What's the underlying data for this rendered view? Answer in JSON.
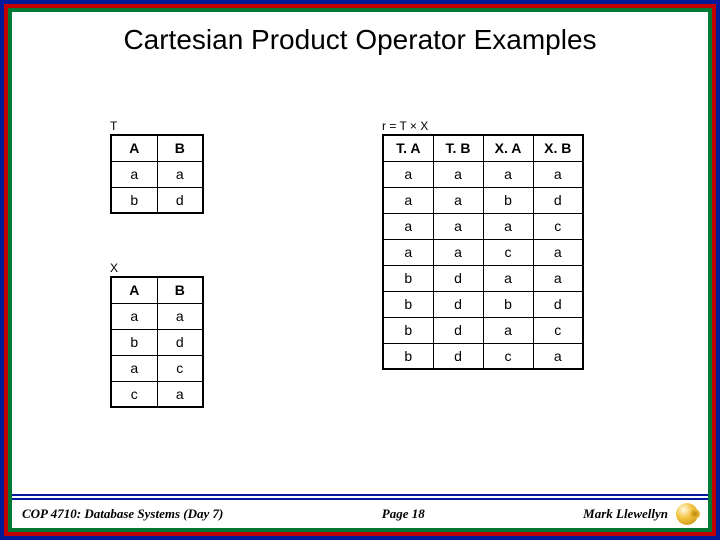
{
  "title": "Cartesian Product Operator Examples",
  "tables": {
    "T": {
      "label": "T",
      "headers": [
        "A",
        "B"
      ],
      "rows": [
        [
          "a",
          "a"
        ],
        [
          "b",
          "d"
        ]
      ]
    },
    "X": {
      "label": "X",
      "headers": [
        "A",
        "B"
      ],
      "rows": [
        [
          "a",
          "a"
        ],
        [
          "b",
          "d"
        ],
        [
          "a",
          "c"
        ],
        [
          "c",
          "a"
        ]
      ]
    },
    "R": {
      "label": "r = T × X",
      "headers": [
        "T. A",
        "T. B",
        "X. A",
        "X. B"
      ],
      "rows": [
        [
          "a",
          "a",
          "a",
          "a"
        ],
        [
          "a",
          "a",
          "b",
          "d"
        ],
        [
          "a",
          "a",
          "a",
          "c"
        ],
        [
          "a",
          "a",
          "c",
          "a"
        ],
        [
          "b",
          "d",
          "a",
          "a"
        ],
        [
          "b",
          "d",
          "b",
          "d"
        ],
        [
          "b",
          "d",
          "a",
          "c"
        ],
        [
          "b",
          "d",
          "c",
          "a"
        ]
      ]
    }
  },
  "footer": {
    "left": "COP 4710: Database Systems (Day 7)",
    "center": "Page 18",
    "right": "Mark Llewellyn"
  }
}
